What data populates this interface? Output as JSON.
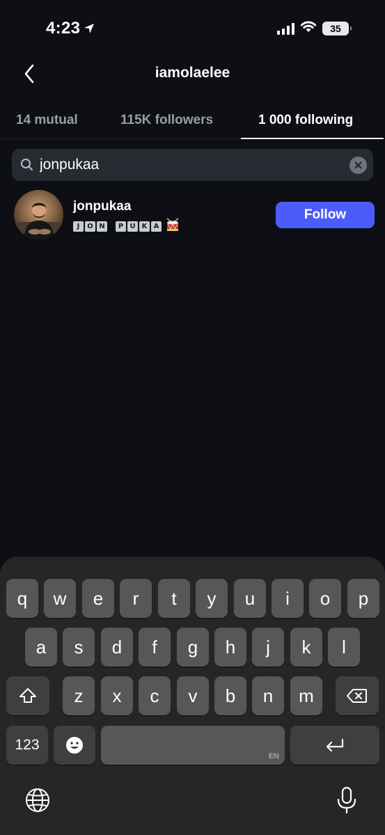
{
  "status_bar": {
    "time": "4:23",
    "battery": "35"
  },
  "header": {
    "title": "iamolaelee"
  },
  "tabs": [
    {
      "label": "14 mutual",
      "active": false
    },
    {
      "label": "115K followers",
      "active": false
    },
    {
      "label": "1 000 following",
      "active": true
    }
  ],
  "search": {
    "value": "jonpukaa"
  },
  "results": [
    {
      "username": "jonpukaa",
      "display_name_letters": [
        "J",
        "O",
        "N",
        " ",
        "P",
        "U",
        "K",
        "A"
      ],
      "display_name_emoji": "drum-icon",
      "follow_label": "Follow"
    }
  ],
  "keyboard": {
    "row1": [
      "q",
      "w",
      "e",
      "r",
      "t",
      "y",
      "u",
      "i",
      "o",
      "p"
    ],
    "row2": [
      "a",
      "s",
      "d",
      "f",
      "g",
      "h",
      "j",
      "k",
      "l"
    ],
    "row3": [
      "z",
      "x",
      "c",
      "v",
      "b",
      "n",
      "m"
    ],
    "numbers_label": "123",
    "space_lang": "EN"
  },
  "colors": {
    "background": "#0d0f14",
    "accent": "#4a5dfb",
    "keyboard": "#262626",
    "key": "#575757"
  }
}
